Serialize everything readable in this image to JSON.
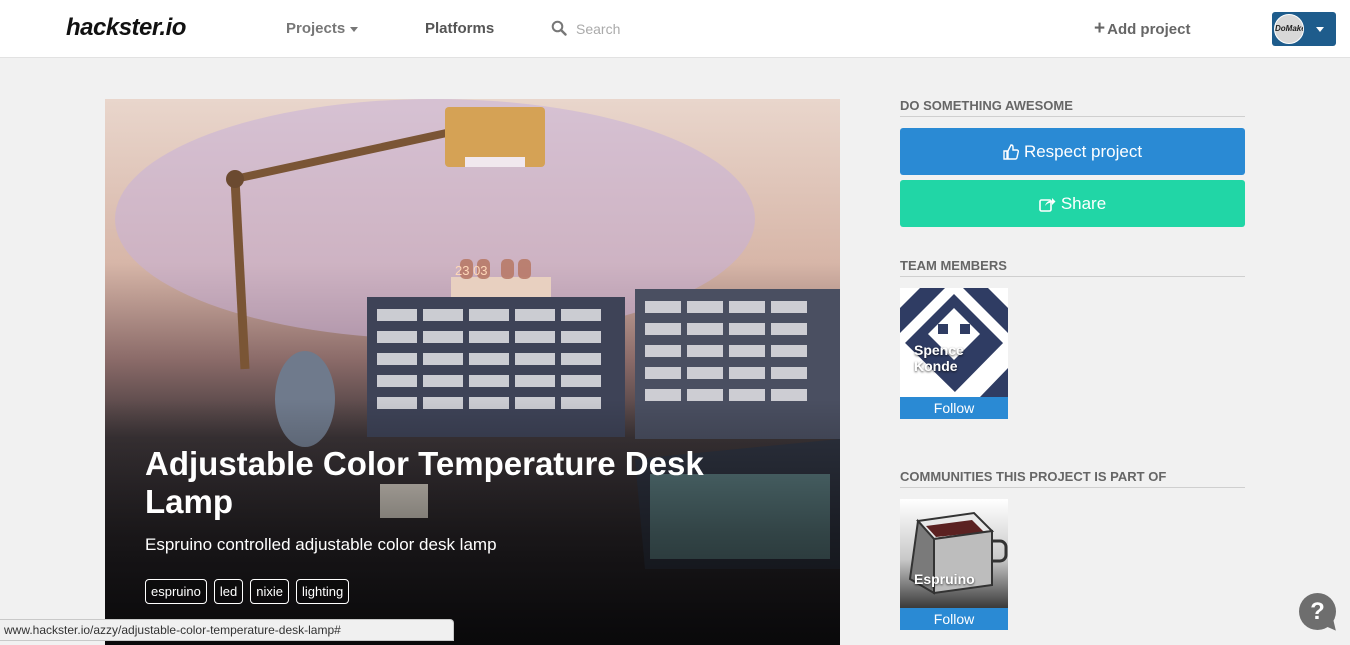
{
  "header": {
    "logo": "hackster.io",
    "nav_projects": "Projects",
    "nav_platforms": "Platforms",
    "search_placeholder": "Search",
    "add_project": "Add project",
    "avatar_text": "DoMake",
    "icons": {
      "search": "search-icon",
      "add": "plus-icon",
      "user_menu": "chevron-down-icon"
    }
  },
  "hero": {
    "title": "Adjustable Color Temperature Desk Lamp",
    "subtitle": "Espruino controlled adjustable color desk lamp",
    "tags": [
      "espruino",
      "led",
      "nixie",
      "lighting"
    ],
    "nixie_digits": "23 03"
  },
  "sidebar": {
    "do_something": "DO SOMETHING AWESOME",
    "respect_label": "Respect project",
    "share_label": "Share",
    "team_members_title": "TEAM MEMBERS",
    "team_members": [
      {
        "name": "Spence Konde",
        "follow_label": "Follow"
      }
    ],
    "communities_title": "COMMUNITIES THIS PROJECT IS PART OF",
    "communities": [
      {
        "name": "Espruino",
        "follow_label": "Follow"
      }
    ],
    "colors": {
      "respect": "#2a8ad4",
      "share": "#21d6a6",
      "follow": "#2a8ad4"
    }
  },
  "status_bar": {
    "url": "www.hackster.io/azzy/adjustable-color-temperature-desk-lamp#"
  },
  "help": {
    "label": "?"
  }
}
